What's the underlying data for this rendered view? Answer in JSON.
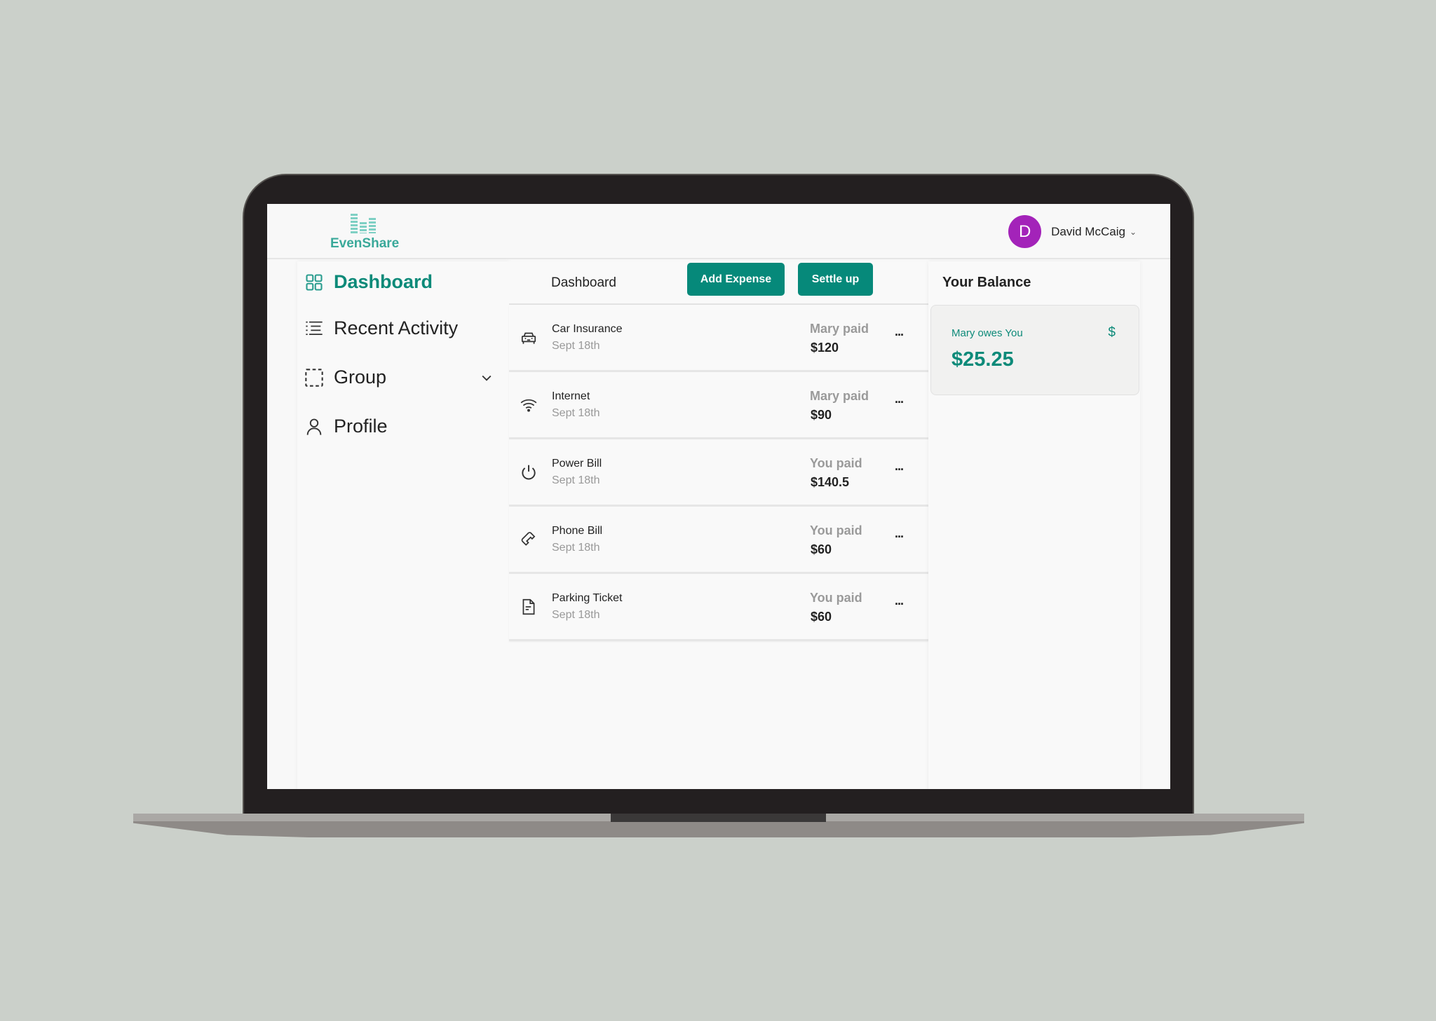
{
  "app": {
    "name": "EvenShare",
    "brand_color": "#0d8a79"
  },
  "header": {
    "user": {
      "initial": "D",
      "name": "David McCaig",
      "avatar_color": "#a323b9"
    }
  },
  "sidebar": {
    "items": [
      {
        "label": "Dashboard",
        "icon": "grid-icon",
        "active": true
      },
      {
        "label": "Recent Activity",
        "icon": "list-icon",
        "active": false
      },
      {
        "label": "Group",
        "icon": "dashed-square-icon",
        "active": false,
        "expandable": true
      },
      {
        "label": "Profile",
        "icon": "user-icon",
        "active": false
      }
    ]
  },
  "main": {
    "title": "Dashboard",
    "add_expense_label": "Add Expense",
    "settle_up_label": "Settle up",
    "expenses": [
      {
        "name": "Car Insurance",
        "date": "Sept 18th",
        "payer": "Mary paid",
        "amount": "$120",
        "icon": "car-icon"
      },
      {
        "name": "Internet",
        "date": "Sept 18th",
        "payer": "Mary paid",
        "amount": "$90",
        "icon": "wifi-icon"
      },
      {
        "name": "Power Bill",
        "date": "Sept 18th",
        "payer": "You paid",
        "amount": "$140.5",
        "icon": "power-icon"
      },
      {
        "name": "Phone Bill",
        "date": "Sept 18th",
        "payer": "You paid",
        "amount": "$60",
        "icon": "phone-icon"
      },
      {
        "name": "Parking Ticket",
        "date": "Sept 18th",
        "payer": "You paid",
        "amount": "$60",
        "icon": "document-icon"
      }
    ],
    "more_label": "..."
  },
  "balance": {
    "title": "Your Balance",
    "label": "Mary owes You",
    "icon_glyph": "$",
    "value": "$25.25"
  }
}
